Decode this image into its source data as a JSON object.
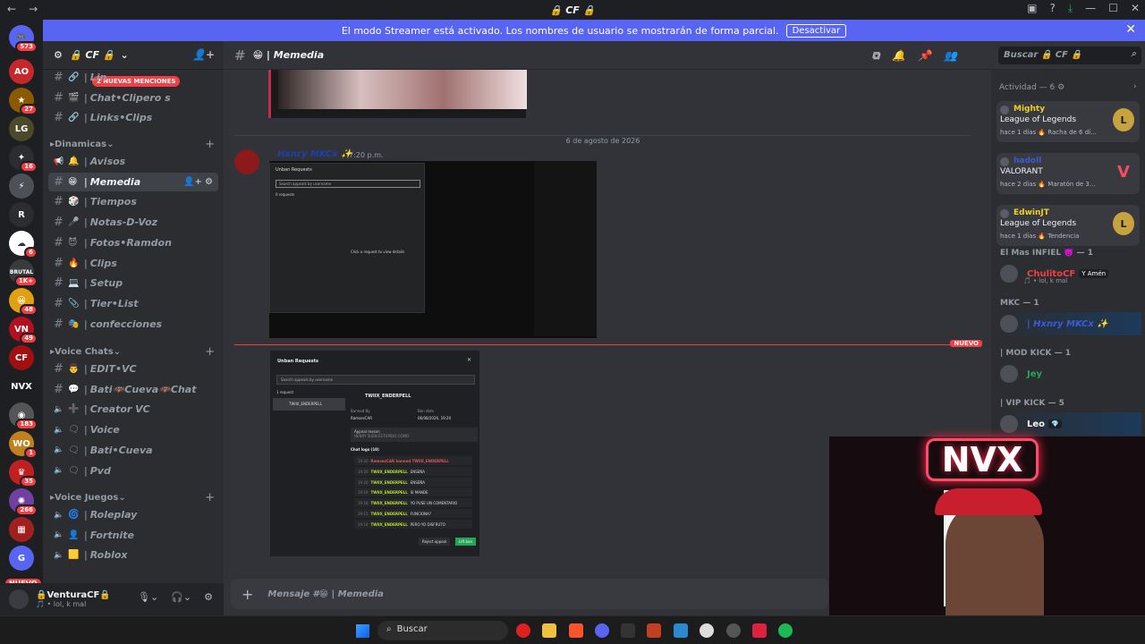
{
  "titlebar": {
    "title": "🔒 𝘾𝙁 🔒",
    "back": "←",
    "forward": "→",
    "inbox": "▣",
    "help": "?",
    "download": "⤓",
    "minimize": "—",
    "maximize": "☐",
    "close": "✕"
  },
  "banner": {
    "text": "El modo Streamer está activado. Los nombres de usuario se mostrarán de forma parcial.",
    "button": "Desactivar",
    "close": "✕"
  },
  "servers": {
    "home_badge": "573",
    "items": [
      {
        "label": "AO",
        "badge": "",
        "color": "#c62828"
      },
      {
        "label": "★",
        "badge": "27",
        "color": "#8b5a00"
      },
      {
        "label": "LG",
        "badge": "",
        "color": "#4a4a2a"
      },
      {
        "label": "✦",
        "badge": "16",
        "color": "#2b2d31"
      },
      {
        "label": "⚡",
        "badge": "",
        "color": "#4e5058"
      },
      {
        "label": "R",
        "badge": "",
        "color": "#2b2d31"
      },
      {
        "label": "☁",
        "badge": "6",
        "color": "#ffffff"
      },
      {
        "label": "BRUTAL",
        "badge": "1K+",
        "color": "#3a3a3a"
      },
      {
        "label": "😀",
        "badge": "48",
        "color": "#e0a010"
      },
      {
        "label": "VN",
        "badge": "49",
        "color": "#b01020"
      },
      {
        "label": "CF",
        "badge": "",
        "color": "#a01010"
      },
      {
        "label": "NVX",
        "badge": "",
        "color": "#1e1f22"
      },
      {
        "label": "◉",
        "badge": "183",
        "color": "#555"
      },
      {
        "label": "WO",
        "badge": "1",
        "color": "#c08020"
      },
      {
        "label": "♛",
        "badge": "35",
        "color": "#c02020"
      },
      {
        "label": "✺",
        "badge": "266",
        "color": "#7040a0"
      },
      {
        "label": "▦",
        "badge": "",
        "color": "#a02020"
      },
      {
        "label": "G",
        "badge": "",
        "color": "#5865f2"
      }
    ],
    "new_pill": "NUEVO"
  },
  "sidebar": {
    "server_name": "🔒 𝘾𝙁 🔒",
    "mentions_pill": "2 NUEVAS MENCIONES",
    "channels_top": [
      {
        "emoji": "🔗",
        "name": "Lin"
      },
      {
        "emoji": "🎬",
        "name": "Chat•Clipero s"
      },
      {
        "emoji": "🔗",
        "name": "Links•Clips"
      }
    ],
    "cat_dinamicas": "Dinamicas",
    "dinamicas": [
      {
        "emoji": "🔔",
        "name": "Avisos",
        "kind": "announce"
      },
      {
        "emoji": "😁",
        "name": "Memedia",
        "kind": "text"
      },
      {
        "emoji": "🎲",
        "name": "Tiempos",
        "kind": "text"
      },
      {
        "emoji": "🎤",
        "name": "Notas-D-Voz",
        "kind": "text"
      },
      {
        "emoji": "😈",
        "name": "Fotos•Ramdon",
        "kind": "text"
      },
      {
        "emoji": "🔥",
        "name": "Clips",
        "kind": "text"
      },
      {
        "emoji": "💻",
        "name": "Setup",
        "kind": "text"
      },
      {
        "emoji": "📎",
        "name": "Tier•List",
        "kind": "text"
      },
      {
        "emoji": "🎭",
        "name": "confecciones",
        "kind": "text"
      }
    ],
    "cat_voice": "Voice Chats",
    "voice": [
      {
        "emoji": "👨",
        "name": "EDIT•VC",
        "kind": "text"
      },
      {
        "emoji": "💬",
        "name": "Bati🦇Cueva🦇Chat",
        "kind": "text"
      },
      {
        "emoji": "➕",
        "name": "Creator VC",
        "kind": "voice"
      },
      {
        "emoji": "🗨",
        "name": "Voice",
        "kind": "voice"
      },
      {
        "emoji": "🗨",
        "name": "Bati•Cueva",
        "kind": "voice"
      },
      {
        "emoji": "🗨",
        "name": "Pvd",
        "kind": "voice"
      }
    ],
    "cat_juegos": "Voice Juegos",
    "juegos": [
      {
        "emoji": "🌀",
        "name": "Roleplay",
        "kind": "voice"
      },
      {
        "emoji": "👤",
        "name": "Fortnite",
        "kind": "voice"
      },
      {
        "emoji": "🟨",
        "name": "Roblox",
        "kind": "voice"
      }
    ]
  },
  "user": {
    "name": "🔒VenturaCF🔒",
    "status": "🎵 • lol, k mal"
  },
  "channel": {
    "name": "😁 | 𝙈𝙚𝙢𝙚𝙙𝙞𝙖",
    "search_placeholder": "Buscar 🔒 𝘾𝙁 🔒",
    "date_divider": "6 de agosto de 2026",
    "author": "Hxnry MKCx ✨",
    "time": "7:20 p.m.",
    "new_label": "NUEVO",
    "composer_placeholder": "Mensaje #😁 | Memedia",
    "shot1": {
      "title": "Unban Requests",
      "search": "Search appeals by username",
      "count": "0 requests",
      "center": "Click a request to view details"
    },
    "shot2": {
      "title": "Unban Requests",
      "search": "Search appeals by username",
      "count": "1 request",
      "user": "TWIIX_ENDERPELL",
      "date": "desde de 19 s",
      "banned_by_label": "Banned By",
      "banned_by": "RamsesCAR",
      "ban_date_label": "Ban date",
      "ban_date": "06/08/2026, 19:20",
      "appeal_label": "Appeal reason",
      "appeal": "HENRY SUEN ESTÚPIDO CÓMO",
      "logs_label": "Chat logs (10)",
      "logs": [
        {
          "t": "19:20",
          "u": "RamsesCAR banned TWIIX_ENDERPELL",
          "m": "",
          "red": true
        },
        {
          "t": "19:20",
          "u": "TWIIX_ENDERPELL",
          "m": "ENSEÑA",
          "red": false
        },
        {
          "t": "19:20",
          "u": "TWIIX_ENDERPELL",
          "m": "ENSEÑA",
          "red": false
        },
        {
          "t": "19:19",
          "u": "TWIIX_ENDERPELL",
          "m": "SI MANDE",
          "red": false
        },
        {
          "t": "19:18",
          "u": "TWIIX_ENDERPELL",
          "m": "YO PUSE UN COMENTARIO",
          "red": false
        },
        {
          "t": "19:15",
          "u": "TWIIX_ENDERPELL",
          "m": "FUNCIONA?",
          "red": false
        },
        {
          "t": "19:14",
          "u": "TWIIX_ENDERPELL",
          "m": "PERO YO DISFRUTO",
          "red": false
        }
      ],
      "reject": "Reject appeal",
      "lift": "Lift ban"
    }
  },
  "activity": {
    "header": "Actividad — 6",
    "cards": [
      {
        "name": "Mighty",
        "name_color": "#f0d020",
        "game": "League of Legends",
        "meta": "hace 1 días  🔥 Racha de 6 dí...",
        "icon": "L",
        "kind": "lol"
      },
      {
        "name": "hadoll",
        "name_color": "#3b5bdb",
        "game": "VALORANT",
        "meta": "hace 2 días  🔥 Maratón de 3...",
        "icon": "V",
        "kind": "val"
      },
      {
        "name": "EdwinJT",
        "name_color": "#f0d020",
        "game": "League of Legends",
        "meta": "hace 1 días  🔥 Tendencia",
        "icon": "L",
        "kind": "lol"
      }
    ],
    "groups": [
      {
        "label": "El Mas INFIEL 👿 — 1"
      },
      {
        "label": "MKC — 1"
      },
      {
        "label": "| MOD KICK — 1"
      },
      {
        "label": "| VIP KICK — 5"
      }
    ],
    "members": [
      {
        "name": "ChulitoCF",
        "color": "#f23f43",
        "tag": "Y Amén",
        "status": "🎵 • lol, k mal"
      },
      {
        "name": "| Hxnry MKCx ✨",
        "color": "#3b5bdb",
        "tag": "",
        "status": ""
      },
      {
        "name": "Jey",
        "color": "#23a55a",
        "tag": "",
        "status": ""
      },
      {
        "name": "Leo",
        "color": "#f2f3f5",
        "tag": "💎",
        "status": ""
      }
    ]
  },
  "webcam": {
    "neon": "NVX"
  },
  "taskbar": {
    "search": "Buscar"
  }
}
